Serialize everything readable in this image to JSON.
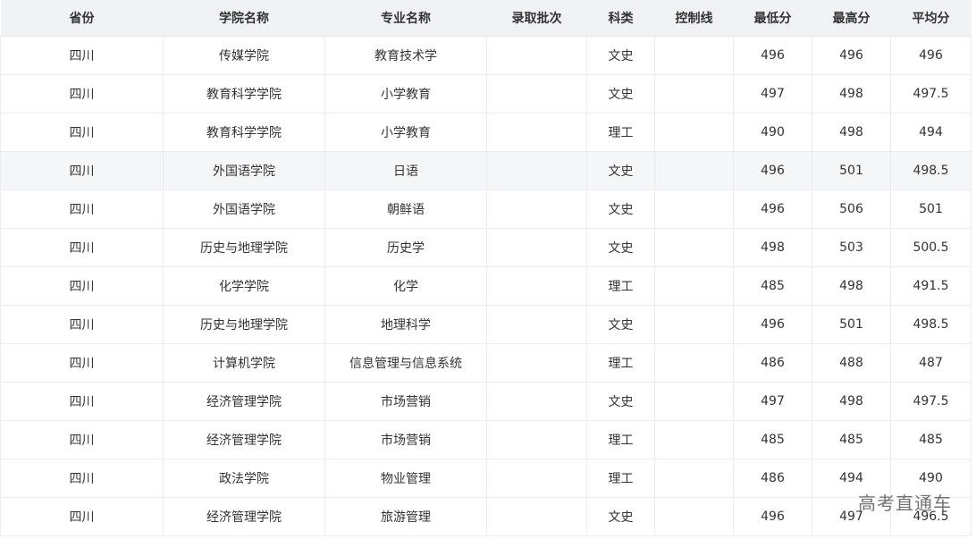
{
  "table": {
    "headers": [
      "省份",
      "学院名称",
      "专业名称",
      "录取批次",
      "科类",
      "控制线",
      "最低分",
      "最高分",
      "平均分"
    ],
    "rows": [
      [
        "四川",
        "传媒学院",
        "教育技术学",
        "",
        "文史",
        "",
        "496",
        "496",
        "496"
      ],
      [
        "四川",
        "教育科学学院",
        "小学教育",
        "",
        "文史",
        "",
        "497",
        "498",
        "497.5"
      ],
      [
        "四川",
        "教育科学学院",
        "小学教育",
        "",
        "理工",
        "",
        "490",
        "498",
        "494"
      ],
      [
        "四川",
        "外国语学院",
        "日语",
        "",
        "文史",
        "",
        "496",
        "501",
        "498.5"
      ],
      [
        "四川",
        "外国语学院",
        "朝鲜语",
        "",
        "文史",
        "",
        "496",
        "506",
        "501"
      ],
      [
        "四川",
        "历史与地理学院",
        "历史学",
        "",
        "文史",
        "",
        "498",
        "503",
        "500.5"
      ],
      [
        "四川",
        "化学学院",
        "化学",
        "",
        "理工",
        "",
        "485",
        "498",
        "491.5"
      ],
      [
        "四川",
        "历史与地理学院",
        "地理科学",
        "",
        "文史",
        "",
        "496",
        "501",
        "498.5"
      ],
      [
        "四川",
        "计算机学院",
        "信息管理与信息系统",
        "",
        "理工",
        "",
        "486",
        "488",
        "487"
      ],
      [
        "四川",
        "经济管理学院",
        "市场营销",
        "",
        "文史",
        "",
        "497",
        "498",
        "497.5"
      ],
      [
        "四川",
        "经济管理学院",
        "市场营销",
        "",
        "理工",
        "",
        "485",
        "485",
        "485"
      ],
      [
        "四川",
        "政法学院",
        "物业管理",
        "",
        "理工",
        "",
        "486",
        "494",
        "490"
      ],
      [
        "四川",
        "经济管理学院",
        "旅游管理",
        "",
        "文史",
        "",
        "496",
        "497",
        "496.5"
      ]
    ],
    "highlighted_row": 3
  },
  "watermark": "高考直通车",
  "colors": {
    "header_bg": "#f1f2f6",
    "highlight_bg": "#f5f6f8",
    "border": "#ececef",
    "text": "#333333"
  }
}
